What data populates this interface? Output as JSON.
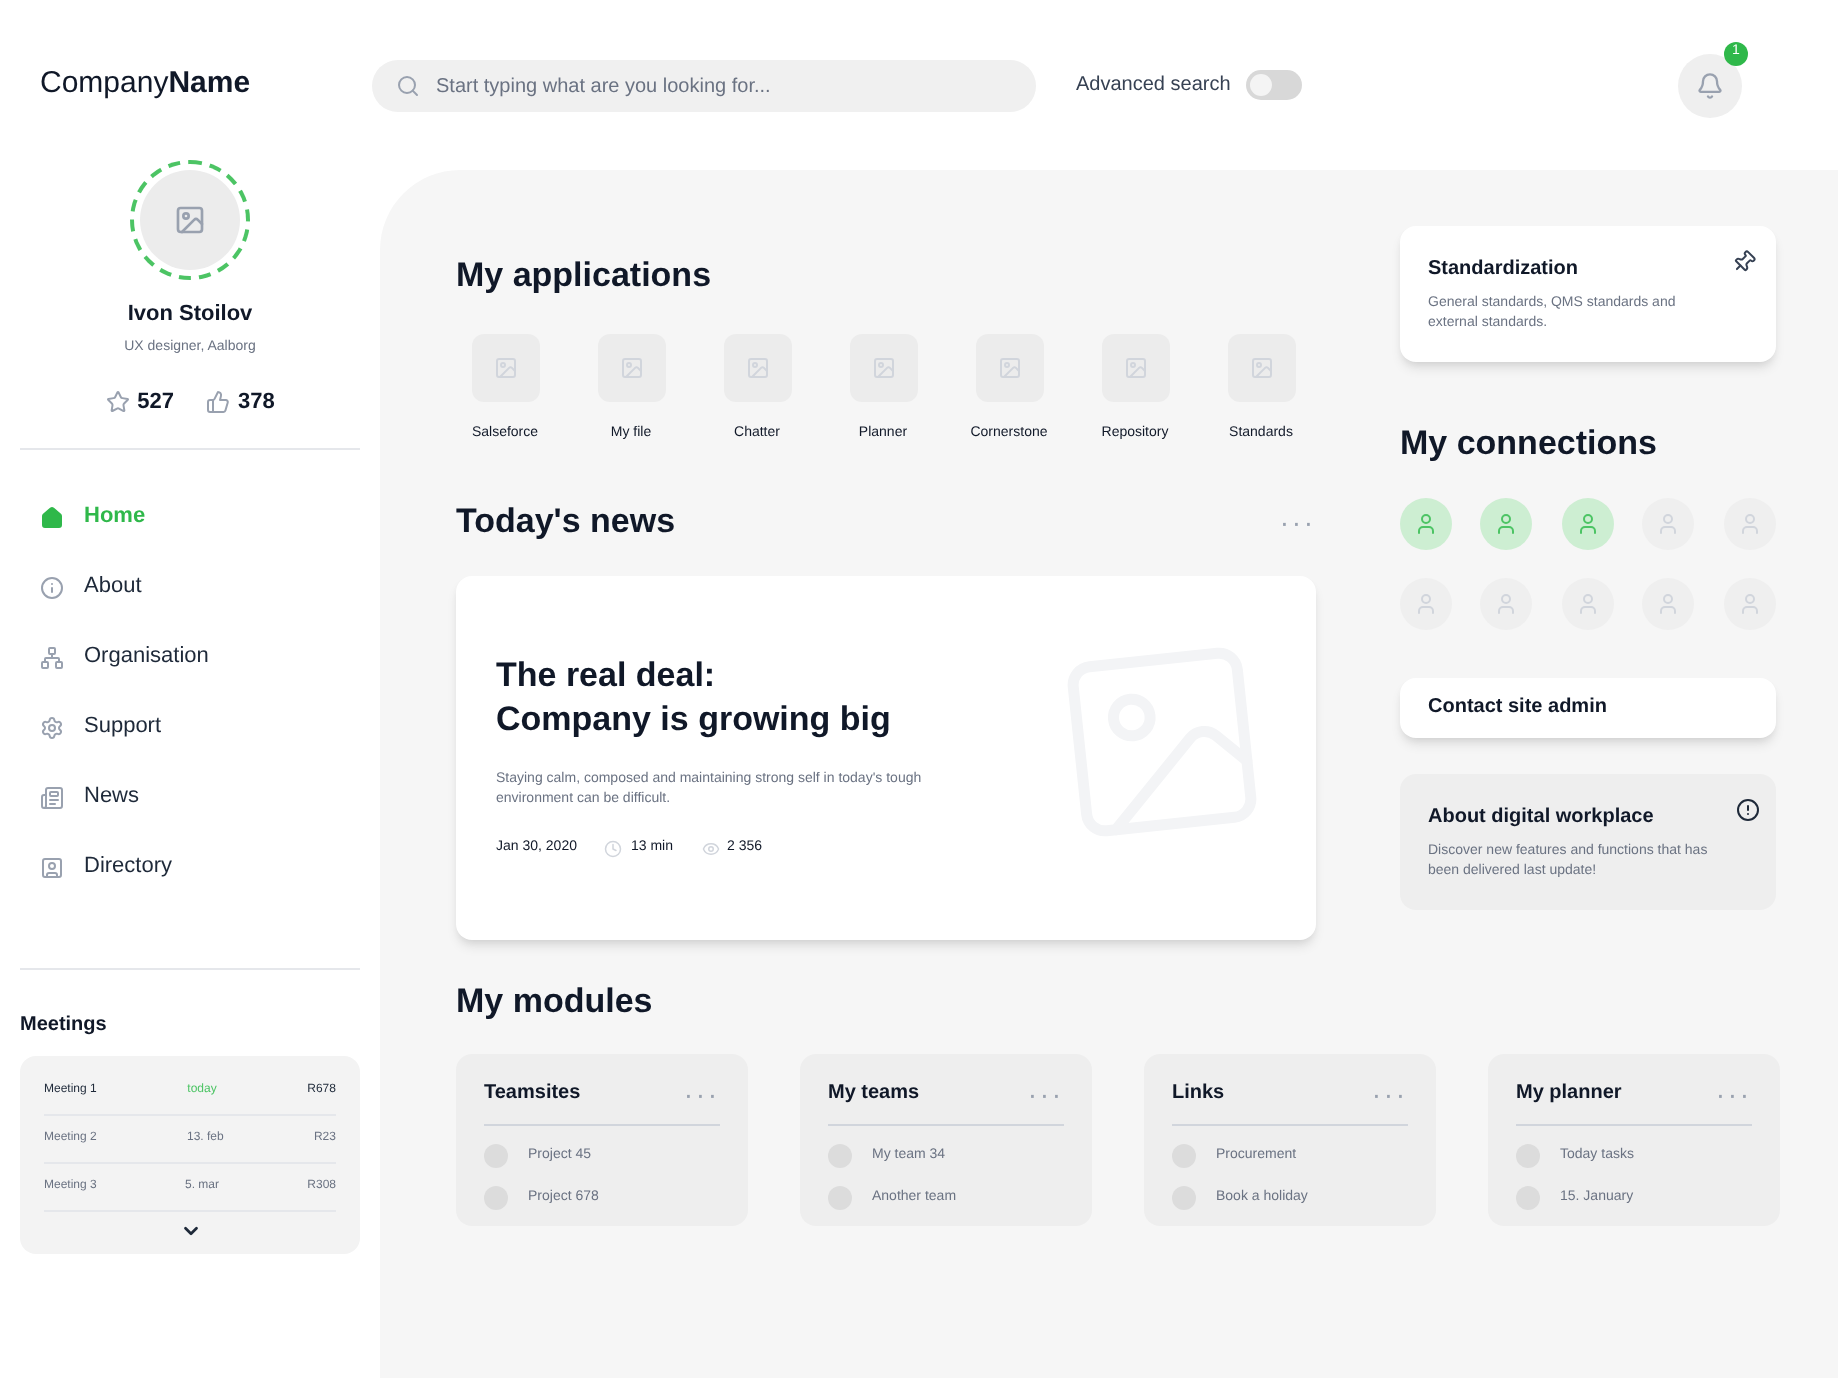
{
  "logo": {
    "text": "Company",
    "bold": "Name"
  },
  "search": {
    "placeholder": "Start typing what are you looking for..."
  },
  "advanced_search": {
    "label": "Advanced search",
    "on": false
  },
  "notifications": {
    "badge": "1"
  },
  "profile": {
    "name": "Ivon Stoilov",
    "role": "UX designer, Aalborg",
    "stars": "527",
    "likes": "378"
  },
  "nav": [
    {
      "label": "Home",
      "selected": true
    },
    {
      "label": "About",
      "selected": false
    },
    {
      "label": "Organisation",
      "selected": false
    },
    {
      "label": "Support",
      "selected": false
    },
    {
      "label": "News",
      "selected": false
    },
    {
      "label": "Directory",
      "selected": false
    }
  ],
  "meetings": {
    "title": "Meetings",
    "rows": [
      {
        "name": "Meeting 1",
        "date": "today",
        "room": "R678",
        "selected": true
      },
      {
        "name": "Meeting 2",
        "date": "13. feb",
        "room": "R23",
        "selected": false
      },
      {
        "name": "Meeting 3",
        "date": "5. mar",
        "room": "R308",
        "selected": false
      }
    ]
  },
  "applications": {
    "title": "My applications",
    "items": [
      "Salseforce",
      "My file",
      "Chatter",
      "Planner",
      "Cornerstone",
      "Repository",
      "Standards"
    ]
  },
  "news": {
    "title": "Today's news",
    "more": "···",
    "headline_1": "The real deal:",
    "headline_2": "Company is growing big",
    "summary": "Staying calm, composed and maintaining strong self in today's tough environment can be difficult.",
    "date": "Jan 30, 2020",
    "read_time": "13 min",
    "views": "2 356"
  },
  "modules": {
    "title": "My modules",
    "cards": [
      {
        "title": "Teamsites",
        "more": "···",
        "items": [
          "Project 45",
          "Project 678"
        ]
      },
      {
        "title": "My teams",
        "more": "···",
        "items": [
          "My team 34",
          "Another team"
        ]
      },
      {
        "title": "Links",
        "more": "···",
        "items": [
          "Procurement",
          "Book a holiday"
        ]
      },
      {
        "title": "My planner",
        "more": "···",
        "items": [
          "Today tasks",
          "15. January"
        ]
      }
    ]
  },
  "standardization": {
    "title": "Standardization",
    "text": "General standards, QMS standards and external standards."
  },
  "connections": {
    "title": "My connections",
    "people": [
      {
        "online": true
      },
      {
        "online": true
      },
      {
        "online": true
      },
      {
        "online": false
      },
      {
        "online": false
      },
      {
        "online": false
      },
      {
        "online": false
      },
      {
        "online": false
      },
      {
        "online": false
      },
      {
        "online": false
      }
    ]
  },
  "contact": {
    "label": "Contact site admin"
  },
  "about": {
    "title": "About digital workplace",
    "text": "Discover new features and functions that has been delivered last update!"
  }
}
